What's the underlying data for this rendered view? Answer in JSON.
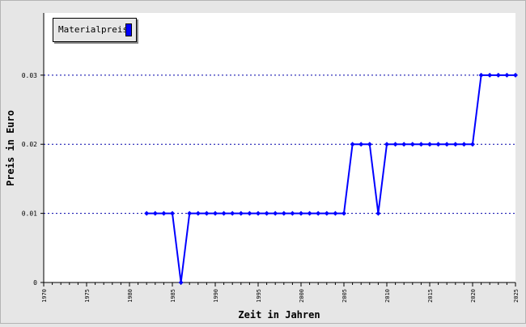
{
  "chart_data": {
    "type": "line",
    "xlabel": "Zeit in Jahren",
    "ylabel": "Preis in Euro",
    "xlim": [
      1970,
      2025
    ],
    "ylim": [
      0,
      0.039
    ],
    "xticks": [
      1970,
      1975,
      1980,
      1985,
      1990,
      1995,
      2000,
      2005,
      2010,
      2015,
      2020,
      2025
    ],
    "xtick_labels": [
      "1970",
      "1975",
      "1980",
      "1985",
      "1990",
      "1995",
      "2000",
      "2005",
      "2010",
      "2015",
      "2020",
      "2025"
    ],
    "yticks": [
      0,
      0.01,
      0.02,
      0.03
    ],
    "ytick_labels": [
      "0",
      "0.01",
      "0.02",
      "0.03"
    ],
    "grid": "horizontal dotted",
    "legend": "top-left",
    "series": [
      {
        "name": "Materialpreis",
        "color": "#0000ff",
        "x": [
          1982,
          1983,
          1984,
          1985,
          1986,
          1987,
          1988,
          1989,
          1990,
          1991,
          1992,
          1993,
          1994,
          1995,
          1996,
          1997,
          1998,
          1999,
          2000,
          2001,
          2002,
          2003,
          2004,
          2005,
          2006,
          2007,
          2008,
          2009,
          2010,
          2011,
          2012,
          2013,
          2014,
          2015,
          2016,
          2017,
          2018,
          2019,
          2020,
          2021,
          2022,
          2023,
          2024,
          2025
        ],
        "y": [
          0.01,
          0.01,
          0.01,
          0.01,
          0,
          0.01,
          0.01,
          0.01,
          0.01,
          0.01,
          0.01,
          0.01,
          0.01,
          0.01,
          0.01,
          0.01,
          0.01,
          0.01,
          0.01,
          0.01,
          0.01,
          0.01,
          0.01,
          0.01,
          0.02,
          0.02,
          0.02,
          0.01,
          0.02,
          0.02,
          0.02,
          0.02,
          0.02,
          0.02,
          0.02,
          0.02,
          0.02,
          0.02,
          0.02,
          0.03,
          0.03,
          0.03,
          0.03,
          0.03
        ]
      }
    ]
  }
}
